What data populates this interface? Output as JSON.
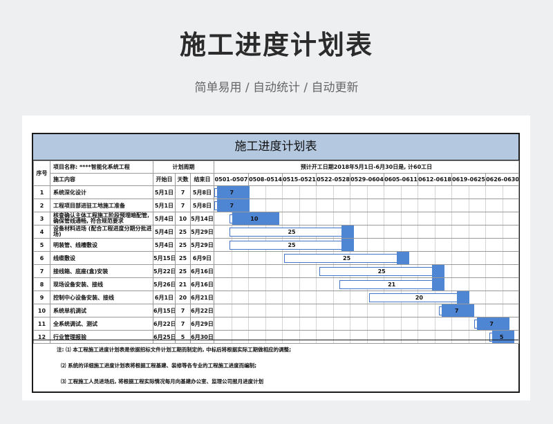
{
  "page": {
    "title": "施工进度计划表",
    "subtitle": "简单易用 / 自动统计 / 自动更新"
  },
  "sheet": {
    "title": "施工进度计划表",
    "header": {
      "seq": "序号",
      "project_label": "项目名称: ****智能化系统工程",
      "plan_period": "计划周期",
      "schedule_note": "预计开工日期2018年5月1日-6月30日是, 计60工日",
      "task_content": "施工内容",
      "start_date": "开始日",
      "days": "天数",
      "end_date": "结束日"
    },
    "weeks": [
      "0501-0507",
      "0508-0514",
      "0515-0521",
      "0522-0528",
      "0529-0604",
      "0605-0611",
      "0612-0618",
      "0619-0625",
      "0626-0630"
    ],
    "rows": [
      {
        "no": "1",
        "task": "系统深化设计",
        "start": "5月1日",
        "days": "7",
        "end": "5月8日"
      },
      {
        "no": "2",
        "task": "工程项目部进驻工地施工准备",
        "start": "5月1日",
        "days": "7",
        "end": "5月8日"
      },
      {
        "no": "3",
        "task": "核查确认主体工程施工阶段预埋暗配管, 确保管线通畅, 符合规范要求",
        "start": "5月4日",
        "days": "10",
        "end": "5月14日"
      },
      {
        "no": "4",
        "task": "设备材料进场 (配合工程进度分期分批进场)",
        "start": "5月4日",
        "days": "25",
        "end": "5月29日"
      },
      {
        "no": "5",
        "task": "明装管、线槽敷设",
        "start": "5月4日",
        "days": "25",
        "end": "5月29日"
      },
      {
        "no": "6",
        "task": "线缆敷设",
        "start": "5月15日",
        "days": "25",
        "end": "6月9日"
      },
      {
        "no": "7",
        "task": "接线箱、底座(盒)安装",
        "start": "5月22日",
        "days": "25",
        "end": "6月16日"
      },
      {
        "no": "8",
        "task": "现场设备安装、接线",
        "start": "5月26日",
        "days": "21",
        "end": "6月16日"
      },
      {
        "no": "9",
        "task": "控制中心设备安装、接线",
        "start": "6月1日",
        "days": "20",
        "end": "6月21日"
      },
      {
        "no": "10",
        "task": "系统单机调试",
        "start": "6月15日",
        "days": "7",
        "end": "6月22日"
      },
      {
        "no": "11",
        "task": "全系统调试、测试",
        "start": "6月22日",
        "days": "7",
        "end": "6月29日"
      },
      {
        "no": "12",
        "task": "行业管理报验",
        "start": "6月25日",
        "days": "5",
        "end": "6月30日"
      }
    ],
    "notes": [
      "注: ⑴ 本工程施工进度计划表是依据招标文件计划工期而制定的, 中标后将根据实际工期做相应的调整;",
      "⑵ 系统的详细施工进度计划表将根据工程基建、装修等各专业的工程施工进度而编制;",
      "⑶ 工程施工人员进场后, 将根据工程实际情况每月向基建办公室、监理公司报月进度计划"
    ]
  },
  "colors": {
    "header_bg": "#b4c8e0",
    "bar_fill": "#4f86d4",
    "bar_border": "#3f74c7"
  }
}
